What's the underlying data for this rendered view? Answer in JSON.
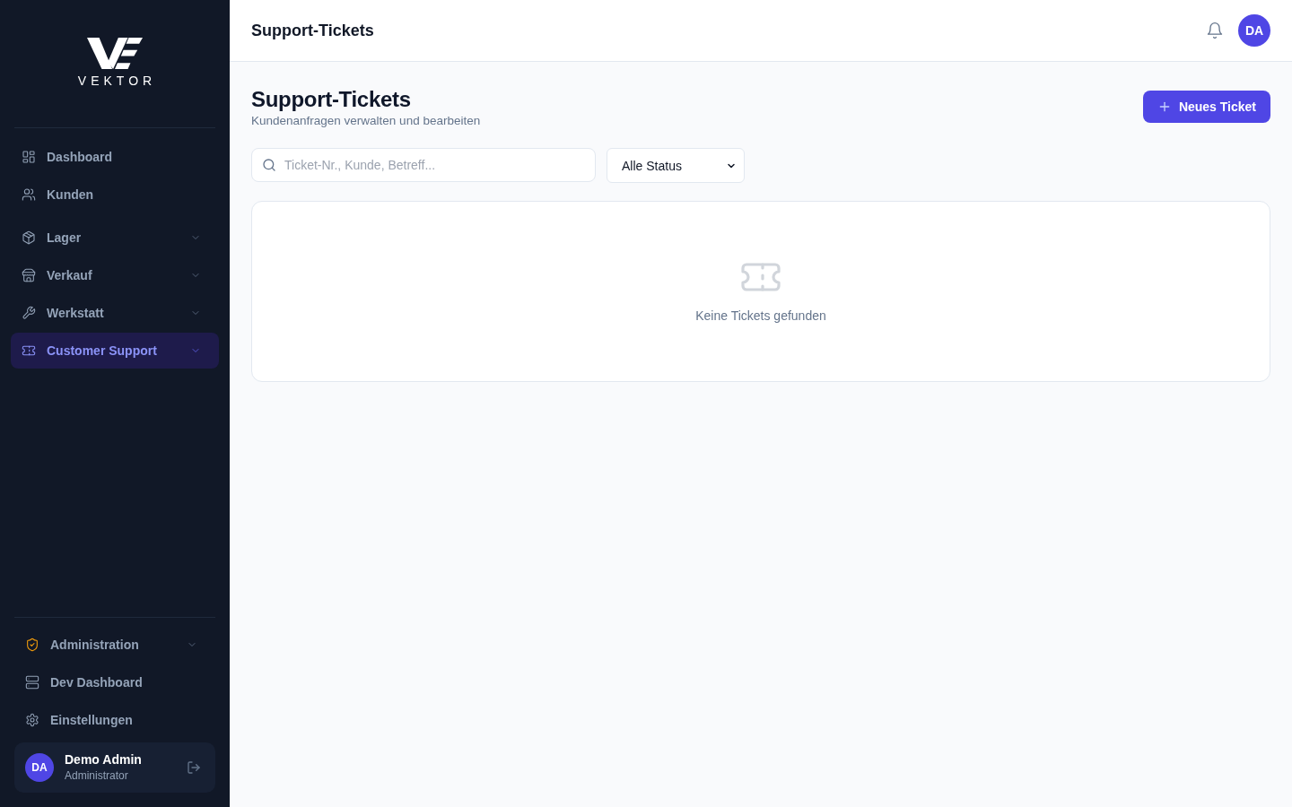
{
  "sidebar": {
    "logo": {
      "wordmark": "VEKTOR"
    },
    "sections": [
      {
        "items": [
          {
            "label": "Dashboard",
            "kind": "link",
            "selected": false
          },
          {
            "label": "Kunden",
            "kind": "link",
            "selected": false
          }
        ]
      },
      {
        "items": [
          {
            "label": "Lager",
            "kind": "group",
            "selected": false
          },
          {
            "label": "Verkauf",
            "kind": "group",
            "selected": false
          },
          {
            "label": "Werkstatt",
            "kind": "group",
            "selected": false
          },
          {
            "label": "Customer Support",
            "kind": "group",
            "selected": true
          }
        ]
      }
    ],
    "footer_items": [
      {
        "label": "Administration",
        "kind": "group",
        "selected": false
      },
      {
        "label": "Dev Dashboard",
        "kind": "link",
        "selected": false
      },
      {
        "label": "Einstellungen",
        "kind": "link",
        "selected": false
      }
    ],
    "user": {
      "initials": "DA",
      "name": "Demo Admin",
      "role": "Administrator"
    }
  },
  "header": {
    "title": "Support-Tickets",
    "avatar_initials": "DA"
  },
  "page": {
    "title": "Support-Tickets",
    "subtitle": "Kundenanfragen verwalten und bearbeiten",
    "new_button": {
      "label": "Neues Ticket"
    }
  },
  "filters": {
    "search": {
      "placeholder": "Ticket-Nr., Kunde, Betreff..."
    },
    "status": {
      "value": "Alle Status"
    }
  },
  "tickets": {
    "empty_message": "Keine Tickets gefunden"
  }
}
